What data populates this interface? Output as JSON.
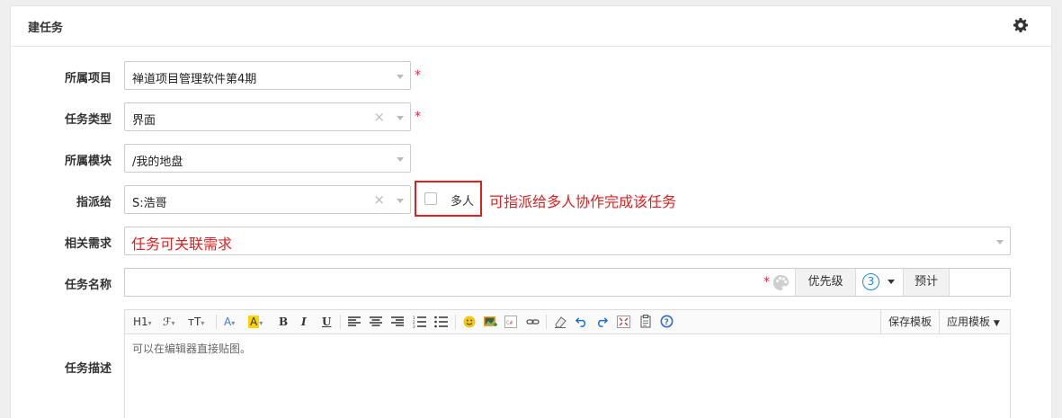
{
  "panel": {
    "title": "建任务"
  },
  "form": {
    "project": {
      "label": "所属项目",
      "value": "禅道项目管理软件第4期"
    },
    "task_type": {
      "label": "任务类型",
      "value": "界面"
    },
    "module": {
      "label": "所属模块",
      "value": "/我的地盘"
    },
    "assign_to": {
      "label": "指派给",
      "value": "S:浩哥",
      "multi_label": "多人"
    },
    "story": {
      "label": "相关需求"
    },
    "task_name": {
      "label": "任务名称",
      "priority_label": "优先级",
      "priority_value": "3",
      "estimate_label": "预计"
    },
    "description": {
      "label": "任务描述",
      "placeholder": "可以在编辑器直接贴图。"
    }
  },
  "toolbar": {
    "heading": "H1",
    "font": "ℱ",
    "size": "ᴛT",
    "font_color": "A",
    "bg_color": "A",
    "bold": "B",
    "italic": "I",
    "underline": "U",
    "save_template": "保存模板",
    "apply_template": "应用模板"
  },
  "annotations": {
    "multi_assign": "可指派给多人协作完成该任务",
    "story_link": "任务可关联需求"
  },
  "colors": {
    "annotation_red": "#e02020",
    "required_red": "#e24",
    "priority_blue": "#1e88e5"
  }
}
